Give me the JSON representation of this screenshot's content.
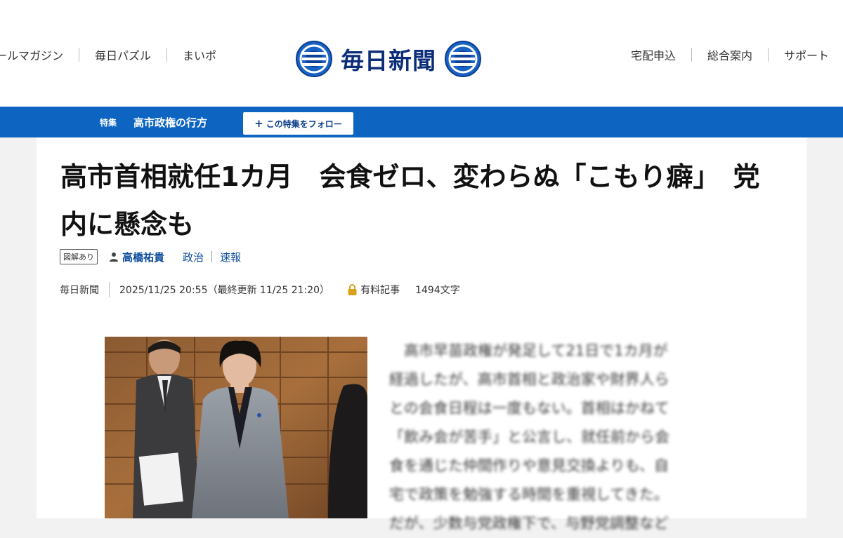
{
  "header": {
    "left_nav": [
      "ールマガジン",
      "毎日パズル",
      "まいポ"
    ],
    "right_nav": [
      "宅配申込",
      "総合案内",
      "サポート"
    ],
    "logo_text": "毎日新聞"
  },
  "feature": {
    "tag": "特集",
    "title": "高市政権の行方",
    "follow_label": "この特集をフォロー",
    "follow_icon": "plus-icon"
  },
  "article": {
    "headline": "高市首相就任1カ月　会食ゼロ、変わらぬ「こもり癖」　党内に懸念も",
    "badge": "図解あり",
    "author": "高橋祐貴",
    "categories": [
      "政治",
      "速報"
    ],
    "source": "毎日新聞",
    "datetime": "2025/11/25 20:55（最終更新 11/25 21:20）",
    "paid_label": "有料記事",
    "char_count": "1494文字",
    "body_lines": [
      "　高市早苗政権が発足して21日で1カ月が",
      "経過したが、高市首相と政治家や財界人ら",
      "との会食日程は一度もない。首相はかねて",
      "「飲み会が苦手」と公言し、就任前から会",
      "食を通じた仲間作りや意見交換よりも、自",
      "宅で政策を勉強する時間を重視してきた。",
      "だが、少数与党政権下で、与野党調整など"
    ]
  },
  "colors": {
    "feature_bar": "#0d64c1",
    "link_blue": "#0c4a9c",
    "logo_blue": "#0c2d78",
    "lock_gold": "#d9a21b"
  }
}
